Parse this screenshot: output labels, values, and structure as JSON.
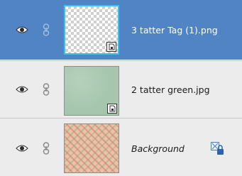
{
  "layers_panel": {
    "layers": [
      {
        "name": "3 tatter Tag (1).png",
        "selected": true,
        "visible": true,
        "smart_object": true
      },
      {
        "name": "2 tatter green.jpg",
        "selected": false,
        "visible": true,
        "smart_object": true
      },
      {
        "name": "Background",
        "selected": false,
        "visible": true,
        "locked": true
      }
    ]
  },
  "colors": {
    "selected_row": "#5184c4",
    "row_background": "#ececec",
    "selected_thumb_border": "#39c0ee"
  }
}
